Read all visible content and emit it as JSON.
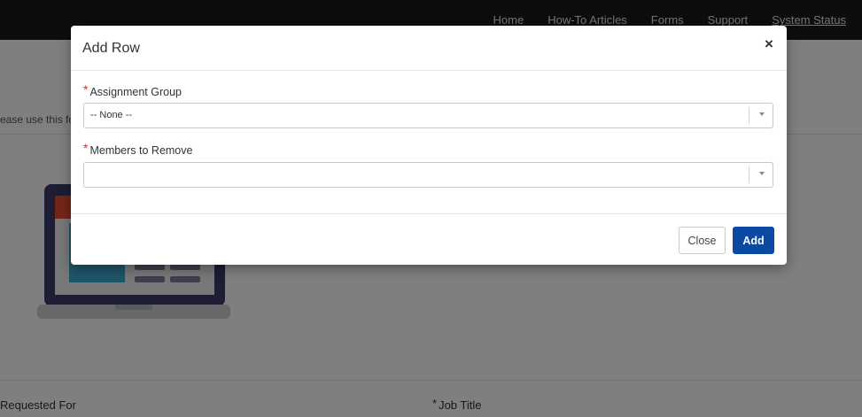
{
  "nav": {
    "links": [
      "Home",
      "How-To Articles",
      "Forms",
      "Support",
      "System Status"
    ]
  },
  "page": {
    "intro_text": "ease use this for",
    "fields": {
      "requested_for": "Requested For",
      "job_title_required": "*",
      "job_title": "Job Title"
    }
  },
  "modal": {
    "title": "Add Row",
    "close_glyph": "×",
    "assignment_group": {
      "required": "*",
      "label": "Assignment Group",
      "value": "-- None --"
    },
    "members_to_remove": {
      "required": "*",
      "label": "Members to Remove",
      "value": ""
    },
    "buttons": {
      "close": "Close",
      "add": "Add"
    }
  },
  "colors": {
    "primary_button": "#0b4aa2",
    "required_marker": "#c23934",
    "nav_background": "#1b1b1b",
    "illustration_frame": "#3b3b6b",
    "illustration_accent": "#e84c2d",
    "illustration_screen": "#3aa8d0"
  }
}
